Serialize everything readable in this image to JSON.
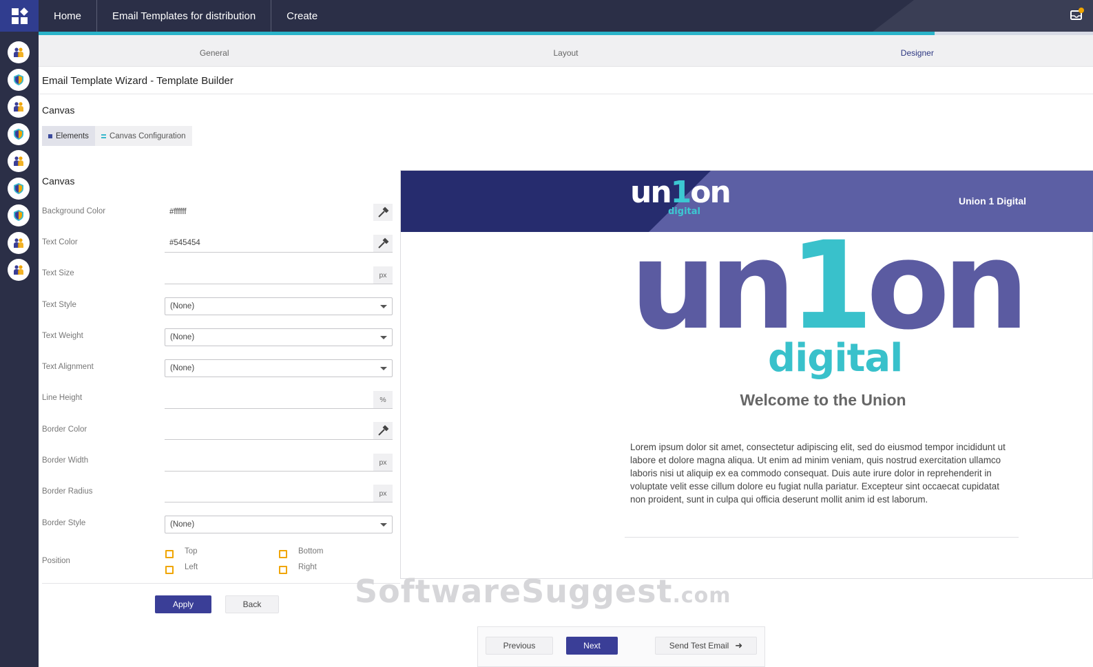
{
  "topbar": {
    "nav": [
      "Home",
      "Email Templates for distribution",
      "Create"
    ],
    "progress_fraction": 0.85
  },
  "sidebar": {
    "icons": [
      "users-icon",
      "shield-icon",
      "users-icon",
      "shield-icon",
      "users-icon",
      "shield-icon",
      "shield-icon",
      "users-icon",
      "users-icon"
    ]
  },
  "tabs": [
    {
      "label": "General",
      "active": false
    },
    {
      "label": "Layout",
      "active": false
    },
    {
      "label": "Designer",
      "active": true
    }
  ],
  "page_title": "Email Template Wizard - Template Builder",
  "canvas_section_title": "Canvas",
  "subtabs": {
    "elements": "Elements",
    "canvas_config": "Canvas Configuration"
  },
  "form": {
    "title": "Canvas",
    "background_color": {
      "label": "Background Color",
      "value": "#ffffff"
    },
    "text_color": {
      "label": "Text Color",
      "value": "#545454"
    },
    "text_size": {
      "label": "Text Size",
      "value": "",
      "suffix": "px"
    },
    "text_style": {
      "label": "Text Style",
      "value": "(None)"
    },
    "text_weight": {
      "label": "Text Weight",
      "value": "(None)"
    },
    "text_alignment": {
      "label": "Text Alignment",
      "value": "(None)"
    },
    "line_height": {
      "label": "Line Height",
      "value": "",
      "suffix": "%"
    },
    "border_color": {
      "label": "Border Color",
      "value": ""
    },
    "border_width": {
      "label": "Border Width",
      "value": "",
      "suffix": "px"
    },
    "border_radius": {
      "label": "Border Radius",
      "value": "",
      "suffix": "px"
    },
    "border_style": {
      "label": "Border Style",
      "value": "(None)"
    },
    "position": {
      "label": "Position",
      "top": "Top",
      "bottom": "Bottom",
      "left": "Left",
      "right": "Right"
    },
    "apply": "Apply",
    "back": "Back"
  },
  "preview": {
    "header_logo_main": "un",
    "header_logo_one": "1",
    "header_logo_end": "on",
    "header_logo_sub": "digital",
    "header_right": "Union 1 Digital",
    "big_logo_main": "un",
    "big_logo_one": "1",
    "big_logo_end": "on",
    "big_logo_sub": "digital",
    "welcome": "Welcome to the Union",
    "body": "Lorem ipsum dolor sit amet, consectetur adipiscing elit, sed do eiusmod tempor incididunt ut labore et dolore magna aliqua. Ut enim ad minim veniam, quis nostrud exercitation ullamco laboris nisi ut aliquip ex ea commodo consequat. Duis aute irure dolor in reprehenderit in voluptate velit esse cillum dolore eu fugiat nulla pariatur. Excepteur sint occaecat cupidatat non proident, sunt in culpa qui officia deserunt mollit anim id est laborum."
  },
  "watermark": {
    "main": "SoftwareSuggest",
    "suffix": ".com"
  },
  "footer": {
    "previous": "Previous",
    "next": "Next",
    "send_test": "Send Test Email"
  },
  "colors": {
    "primary": "#3a3e97",
    "navy": "#2b2f47",
    "teal": "#39c1cb",
    "purple": "#5b5ba1",
    "checkbox": "#f0a500"
  }
}
